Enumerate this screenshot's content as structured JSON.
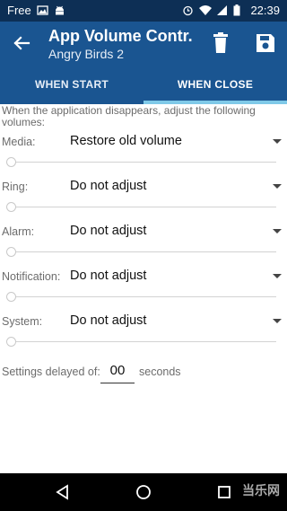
{
  "status_bar": {
    "carrier": "Free",
    "time": "22:39",
    "icons": [
      "image-icon",
      "android-icon",
      "alarm-icon",
      "wifi-icon",
      "signal-icon",
      "battery-icon"
    ]
  },
  "app_bar": {
    "title": "App Volume Contr...",
    "subtitle": "Angry Birds 2",
    "actions": [
      "delete-icon",
      "save-icon"
    ]
  },
  "tabs": [
    {
      "label": "WHEN START",
      "selected": false
    },
    {
      "label": "WHEN CLOSE",
      "selected": true
    }
  ],
  "intro_text": "When the application disappears, adjust the following volumes:",
  "volumes": [
    {
      "label": "Media:",
      "value": "Restore old volume"
    },
    {
      "label": "Ring:",
      "value": "Do not adjust"
    },
    {
      "label": "Alarm:",
      "value": "Do not adjust"
    },
    {
      "label": "Notification:",
      "value": "Do not adjust"
    },
    {
      "label": "System:",
      "value": "Do not adjust"
    }
  ],
  "delay": {
    "label": "Settings delayed of:",
    "value": "00",
    "unit": "seconds"
  },
  "nav_bar": {
    "buttons": [
      "back-triangle-icon",
      "home-circle-icon",
      "recents-square-icon"
    ],
    "watermark": "当乐网"
  },
  "colors": {
    "status_bar": "#0d2f55",
    "app_bar": "#1a5591",
    "tab_indicator": "#7fc9e8"
  }
}
